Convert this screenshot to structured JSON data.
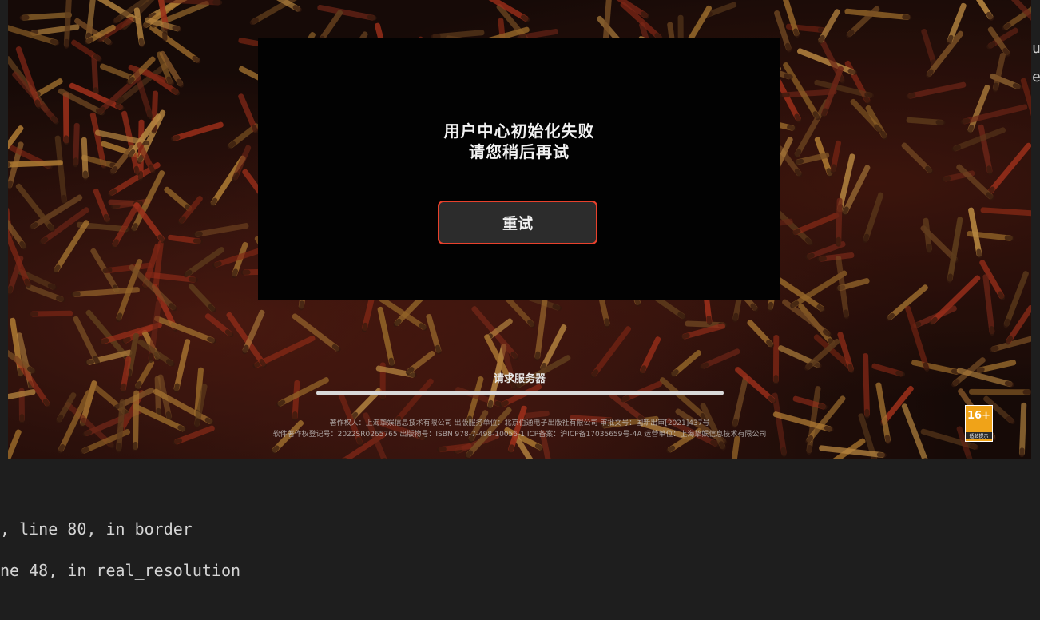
{
  "dialog": {
    "message_line1": "用户中心初始化失败",
    "message_line2": "请您稍后再试",
    "retry_label": "重试"
  },
  "loading": {
    "status": "请求服务器",
    "progress": 1.0
  },
  "legal": {
    "line1": "著作权人：上海挚娱信息技术有限公司 出版服务单位：北京伯通电子出版社有限公司 审批文号：国新出审[2021]437号",
    "line2": "软件著作权登记号：2022SR0265765 出版物号：ISBN 978-7-498-10056-1 ICP备案：沪ICP备17035659号-4A 运营单位：上海挚娱信息技术有限公司"
  },
  "age_badge": {
    "rating": "16+",
    "label": "适龄提示",
    "color": "#f0a318"
  },
  "terminal": {
    "line1": ", line 80, in border",
    "line2": "ne 48, in real_resolution"
  },
  "colors": {
    "accent_border": "#e8412c",
    "panel_bg": "#020202",
    "button_bg": "#2c2c2c"
  }
}
